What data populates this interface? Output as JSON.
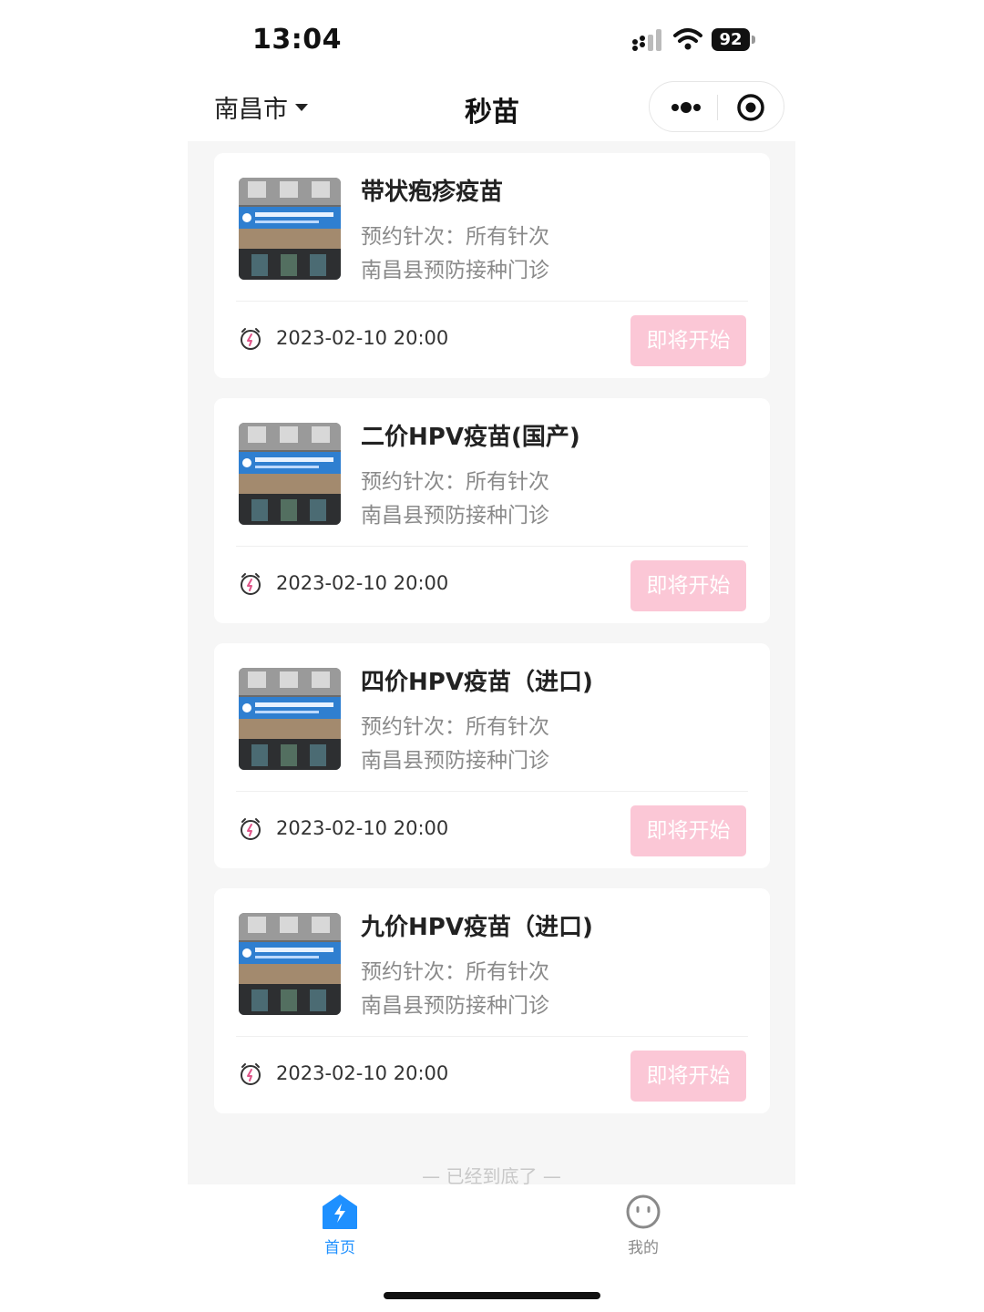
{
  "status_bar": {
    "time": "13:04",
    "battery": "92"
  },
  "nav": {
    "city": "南昌市",
    "title": "秒苗"
  },
  "cards": [
    {
      "name": "带状疱疹疫苗",
      "doses": "预约针次：所有针次",
      "site": "南昌县预防接种门诊",
      "time": "2023-02-10 20:00",
      "button": "即将开始"
    },
    {
      "name": "二价HPV疫苗(国产)",
      "doses": "预约针次：所有针次",
      "site": "南昌县预防接种门诊",
      "time": "2023-02-10 20:00",
      "button": "即将开始"
    },
    {
      "name": "四价HPV疫苗（进口)",
      "doses": "预约针次：所有针次",
      "site": "南昌县预防接种门诊",
      "time": "2023-02-10 20:00",
      "button": "即将开始"
    },
    {
      "name": "九价HPV疫苗（进口)",
      "doses": "预约针次：所有针次",
      "site": "南昌县预防接种门诊",
      "time": "2023-02-10 20:00",
      "button": "即将开始"
    }
  ],
  "list_end": "— 已经到底了 —",
  "tabs": [
    {
      "label": "首页",
      "icon": "home-lightning-icon",
      "active": true
    },
    {
      "label": "我的",
      "icon": "smiley-face-icon",
      "active": false
    }
  ],
  "colors": {
    "accent": "#1e90ff",
    "button_disabled": "#fbc7d6",
    "clock": "#e0568a",
    "tab_inactive": "#8a8a8a",
    "background": "#f6f6f6"
  }
}
